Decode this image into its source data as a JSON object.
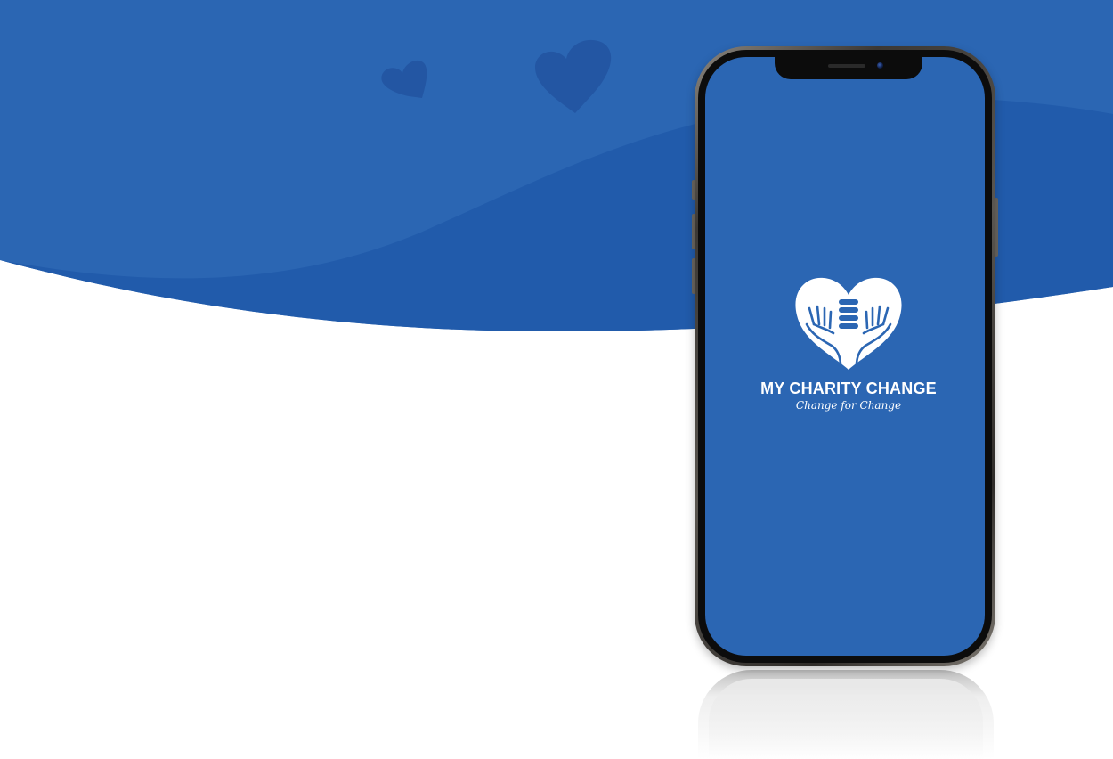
{
  "colors": {
    "background": "#ffffff",
    "wave_light": "#2b66b3",
    "wave_dark": "#215bab",
    "screen": "#2b66b3",
    "logo": "#ffffff"
  },
  "app": {
    "name": "MY CHARITY CHANGE",
    "tagline": "Change for Change"
  },
  "icons": {
    "background_hearts": [
      "heart-icon",
      "heart-icon"
    ],
    "logo": "heart-hands-coins-icon"
  }
}
